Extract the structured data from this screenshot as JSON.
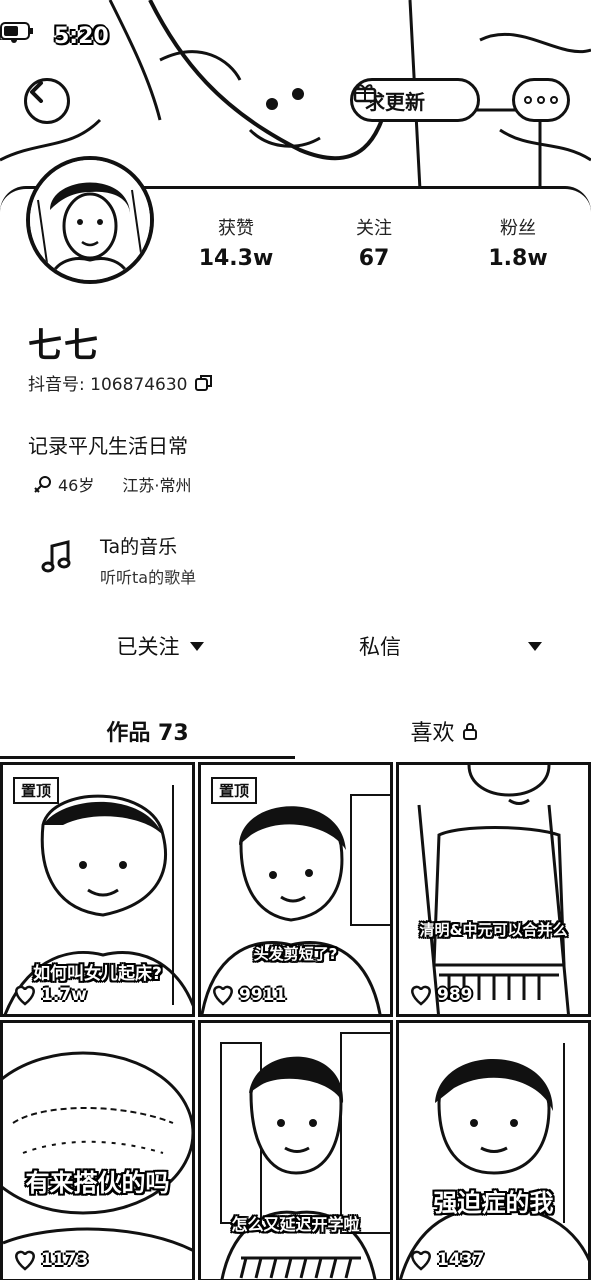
{
  "status_bar": {
    "time": "5:20"
  },
  "header": {
    "update_request_label": "求更新"
  },
  "profile": {
    "stats": [
      {
        "label": "获赞",
        "value": "14.3w"
      },
      {
        "label": "关注",
        "value": "67"
      },
      {
        "label": "粉丝",
        "value": "1.8w"
      }
    ],
    "nickname": "七七",
    "douyin_id": "抖音号: 106874630",
    "bio": "记录平凡生活日常",
    "age": "46岁",
    "location": "江苏·常州"
  },
  "music": {
    "title": "Ta的音乐",
    "subtitle": "听听ta的歌单"
  },
  "actions": {
    "follow_label": "已关注",
    "message_label": "私信"
  },
  "tabs": {
    "works_label": "作品 73",
    "likes_label": "喜欢"
  },
  "videos": [
    {
      "pinned_label": "置顶",
      "caption": "如何叫女儿起床?",
      "likes": "1.7w"
    },
    {
      "pinned_label": "置顶",
      "caption": "头发剪短了?",
      "likes": "9911"
    },
    {
      "caption": "清明&中元可以合并么",
      "likes": "989"
    },
    {
      "caption": "有来搭伙的吗",
      "likes": "1173"
    },
    {
      "caption": "怎么又延迟开学啦",
      "likes": ""
    },
    {
      "caption": "强迫症的我",
      "likes": "1437"
    }
  ]
}
